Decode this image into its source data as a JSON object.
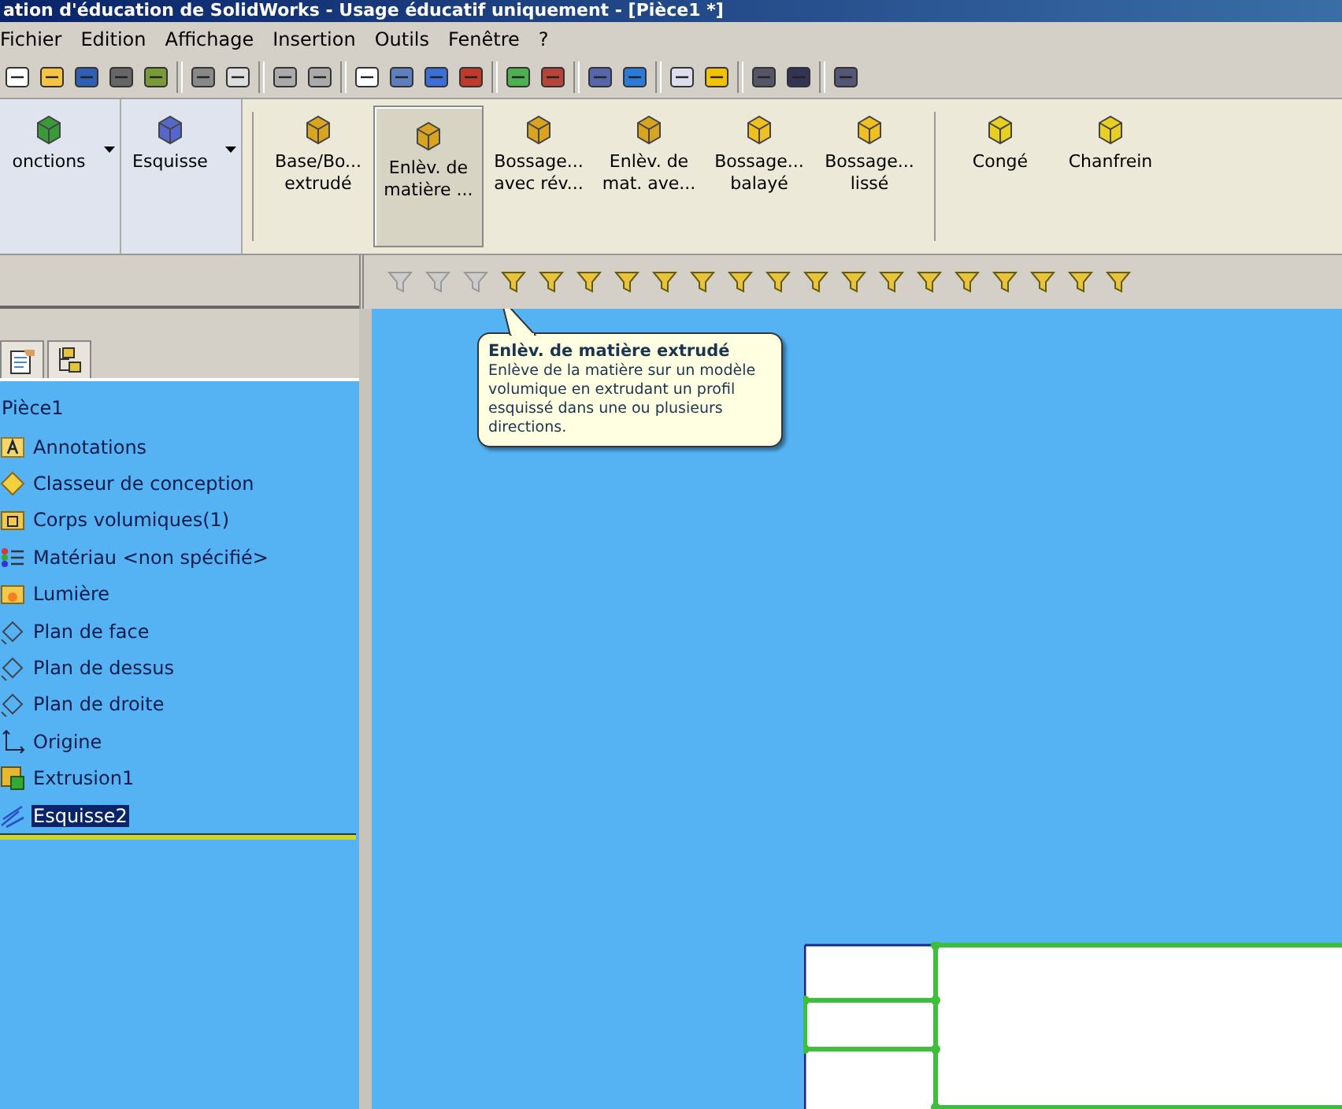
{
  "window": {
    "title": "ation d'éducation de SolidWorks - Usage éducatif uniquement - [Pièce1 *]"
  },
  "menu": [
    "Fichier",
    "Edition",
    "Affichage",
    "Insertion",
    "Outils",
    "Fenêtre",
    "?"
  ],
  "command_manager": [
    {
      "kind": "group",
      "label": "onctions",
      "selected": false
    },
    {
      "kind": "group",
      "label": "Esquisse",
      "selected": false
    },
    {
      "kind": "tool",
      "label": "Base/Bo...\nextrudé",
      "selected": false
    },
    {
      "kind": "tool",
      "label": "Enlèv. de\nmatière ...",
      "selected": true
    },
    {
      "kind": "tool",
      "label": "Bossage...\navec rév...",
      "selected": false
    },
    {
      "kind": "tool",
      "label": "Enlèv. de\nmat. ave...",
      "selected": false
    },
    {
      "kind": "tool",
      "label": "Bossage...\nbalayé",
      "selected": false
    },
    {
      "kind": "tool",
      "label": "Bossage...\nlissé",
      "selected": false
    },
    {
      "kind": "tool",
      "label": "Congé",
      "selected": false
    },
    {
      "kind": "tool",
      "label": "Chanfrein",
      "selected": false
    }
  ],
  "tree": {
    "root": "Pièce1",
    "items": [
      {
        "kind": "annotation",
        "label": "Annotations",
        "selected": false
      },
      {
        "kind": "diamond",
        "label": "Classeur de conception",
        "selected": false
      },
      {
        "kind": "body",
        "label": "Corps volumiques(1)",
        "selected": false
      },
      {
        "kind": "material",
        "label": "Matériau <non spécifié>",
        "selected": false
      },
      {
        "kind": "light",
        "label": "Lumière",
        "selected": false
      },
      {
        "kind": "plane",
        "label": "Plan de face",
        "selected": false
      },
      {
        "kind": "plane",
        "label": "Plan de dessus",
        "selected": false
      },
      {
        "kind": "plane",
        "label": "Plan de droite",
        "selected": false
      },
      {
        "kind": "origin",
        "label": "Origine",
        "selected": false
      },
      {
        "kind": "extrude",
        "label": "Extrusion1",
        "selected": false
      },
      {
        "kind": "sketch",
        "label": "Esquisse2",
        "selected": true
      }
    ]
  },
  "tooltip": {
    "title": "Enlèv. de matière extrudé",
    "text": "Enlève de la matière sur un modèle volumique en extrudant un profil esquissé dans une ou plusieurs directions."
  }
}
